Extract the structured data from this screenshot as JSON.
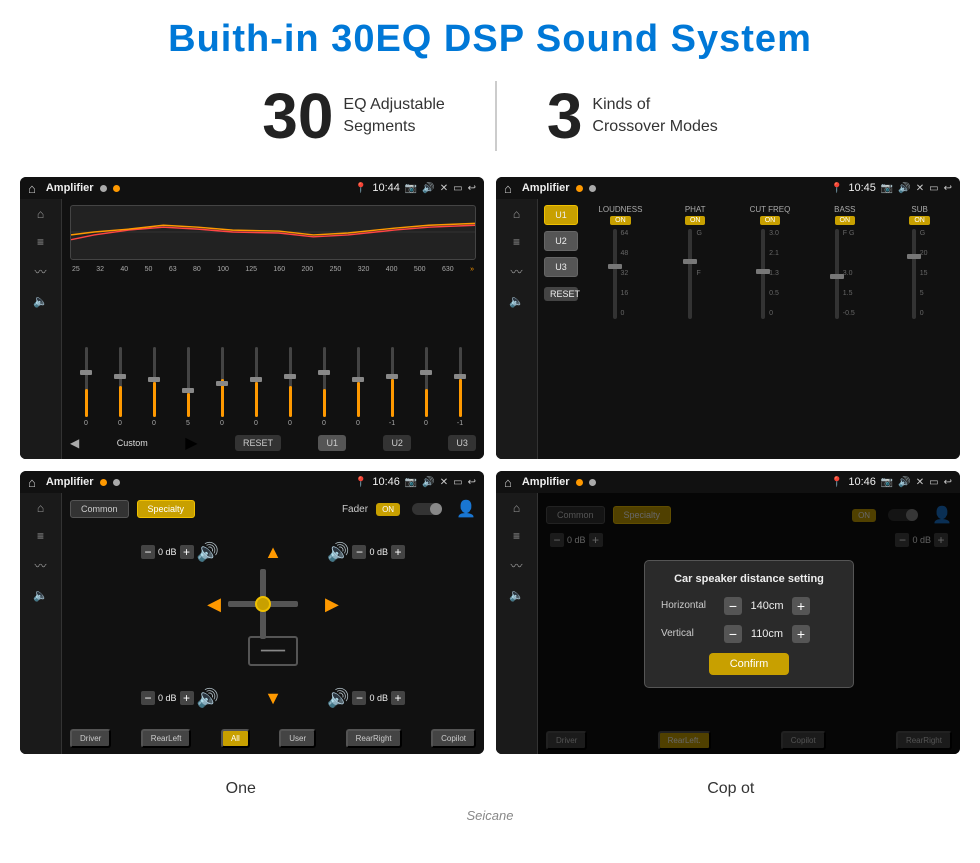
{
  "header": {
    "title": "Buith-in 30EQ DSP Sound System"
  },
  "stats": {
    "eq_number": "30",
    "eq_desc_line1": "EQ Adjustable",
    "eq_desc_line2": "Segments",
    "cross_number": "3",
    "cross_desc_line1": "Kinds of",
    "cross_desc_line2": "Crossover Modes"
  },
  "screen1": {
    "app_name": "Amplifier",
    "time": "10:44",
    "freq_labels": [
      "25",
      "32",
      "40",
      "50",
      "63",
      "80",
      "100",
      "125",
      "160",
      "200",
      "250",
      "320",
      "400",
      "500",
      "630"
    ],
    "slider_values": [
      "0",
      "0",
      "0",
      "5",
      "0",
      "0",
      "0",
      "0",
      "0",
      "-1",
      "0",
      "-1"
    ],
    "custom_label": "Custom",
    "reset_label": "RESET",
    "u1_label": "U1",
    "u2_label": "U2",
    "u3_label": "U3"
  },
  "screen2": {
    "app_name": "Amplifier",
    "time": "10:45",
    "u1_label": "U1",
    "u2_label": "U2",
    "u3_label": "U3",
    "on_label": "ON",
    "reset_label": "RESET",
    "channels": [
      {
        "name": "LOUDNESS",
        "on": true
      },
      {
        "name": "PHAT",
        "on": true
      },
      {
        "name": "CUT FREQ",
        "on": true
      },
      {
        "name": "BASS",
        "on": true
      },
      {
        "name": "SUB",
        "on": true
      }
    ]
  },
  "screen3": {
    "app_name": "Amplifier",
    "time": "10:46",
    "tab_common": "Common",
    "tab_specialty": "Specialty",
    "fader_label": "Fader",
    "on_label": "ON",
    "speaker_values": {
      "front_left": "0 dB",
      "front_right": "0 dB",
      "rear_left": "0 dB",
      "rear_right": "0 dB"
    },
    "btn_driver": "Driver",
    "btn_rear_left": "RearLeft",
    "btn_all": "All",
    "btn_user": "User",
    "btn_rear_right": "RearRight",
    "btn_copilot": "Copilot"
  },
  "screen4": {
    "app_name": "Amplifier",
    "time": "10:46",
    "tab_common": "Common",
    "tab_specialty": "Specialty",
    "dialog_title": "Car speaker distance setting",
    "horizontal_label": "Horizontal",
    "horizontal_value": "140cm",
    "vertical_label": "Vertical",
    "vertical_value": "110cm",
    "confirm_label": "Confirm",
    "on_label": "ON",
    "btn_driver": "Driver",
    "btn_rear_left": "RearLeft.",
    "btn_copilot": "Copilot",
    "btn_rear_right": "RearRight",
    "eq_value1": "0 dB",
    "eq_value2": "0 dB"
  },
  "bottom_labels": {
    "one_label": "One",
    "copilot_label": "Cop ot"
  },
  "watermark": "Seicane"
}
